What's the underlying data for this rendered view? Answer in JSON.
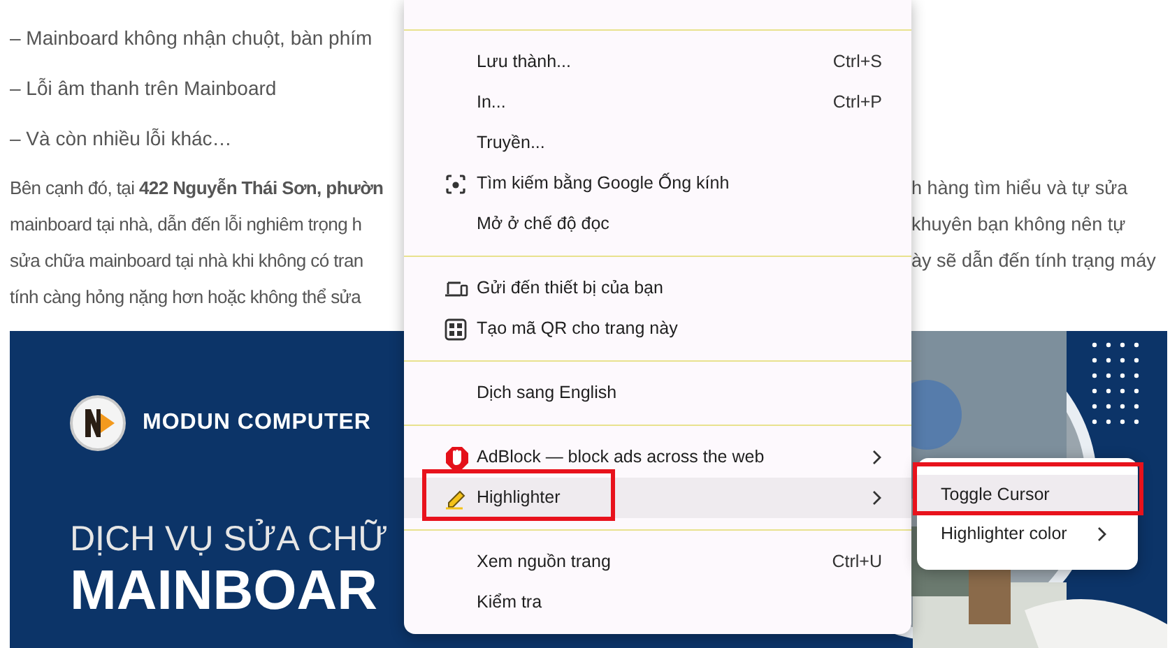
{
  "article": {
    "list_items": [
      "– Mainboard không nhận chuột, bàn phím",
      "– Lỗi âm thanh trên Mainboard",
      "– Và còn nhiều lỗi khác…"
    ],
    "paragraph_lines": [
      {
        "left": "Bên cạnh đó, tại **422 Nguyễn Thái Sơn, phườn**",
        "right": "h hàng tìm hiểu và tự sửa"
      },
      {
        "left": "mainboard tại nhà, dẫn đến lỗi nghiêm trọng h",
        "right": "khuyên bạn không nên tự"
      },
      {
        "left": "sửa chữa mainboard tại nhà khi không có tran",
        "right": "ày sẽ dẫn đến tính trạng máy"
      },
      {
        "left": "tính càng hỏng nặng hơn hoặc không thể sửa"
      }
    ]
  },
  "banner": {
    "brand": "MODUN COMPUTER",
    "headline_1": "DỊCH VỤ SỬA CHỮ",
    "headline_2": "MAINBOAR"
  },
  "context_menu": {
    "groups": [
      [
        {
          "label": "Lưu thành...",
          "shortcut": "Ctrl+S",
          "kind": "plain",
          "highlighted": false,
          "marked": false,
          "submenu": false
        },
        {
          "label": "In...",
          "shortcut": "Ctrl+P",
          "kind": "plain",
          "highlighted": false,
          "marked": false,
          "submenu": false
        },
        {
          "label": "Truyền...",
          "kind": "plain",
          "highlighted": false,
          "marked": false,
          "submenu": false
        },
        {
          "label": "Tìm kiếm bằng Google Ống kính",
          "kind": "lens",
          "highlighted": false,
          "marked": false,
          "submenu": false
        },
        {
          "label": "Mở ở chế độ đọc",
          "kind": "plain",
          "highlighted": false,
          "marked": false,
          "submenu": false
        }
      ],
      [
        {
          "label": "Gửi đến thiết bị của bạn",
          "kind": "devices",
          "highlighted": false,
          "marked": false,
          "submenu": false
        },
        {
          "label": "Tạo mã QR cho trang này",
          "kind": "qr",
          "highlighted": false,
          "marked": false,
          "submenu": false
        }
      ],
      [
        {
          "label": "Dịch sang English",
          "kind": "plain",
          "highlighted": false,
          "marked": false,
          "submenu": false
        }
      ],
      [
        {
          "label": "AdBlock — block ads across the web",
          "kind": "adblock",
          "highlighted": false,
          "marked": false,
          "submenu": true
        },
        {
          "label": "Highlighter",
          "kind": "highlighter",
          "highlighted": true,
          "marked": true,
          "submenu": true
        }
      ],
      [
        {
          "label": "Xem nguồn trang",
          "shortcut": "Ctrl+U",
          "kind": "plain",
          "highlighted": false,
          "marked": false,
          "submenu": false
        },
        {
          "label": "Kiểm tra",
          "kind": "plain",
          "highlighted": false,
          "marked": false,
          "submenu": false
        }
      ]
    ]
  },
  "submenu": {
    "items": [
      {
        "label": "Toggle Cursor",
        "highlighted": true,
        "marked": true,
        "submenu": false
      },
      {
        "label": "Highlighter color",
        "highlighted": false,
        "marked": false,
        "submenu": true
      }
    ]
  }
}
